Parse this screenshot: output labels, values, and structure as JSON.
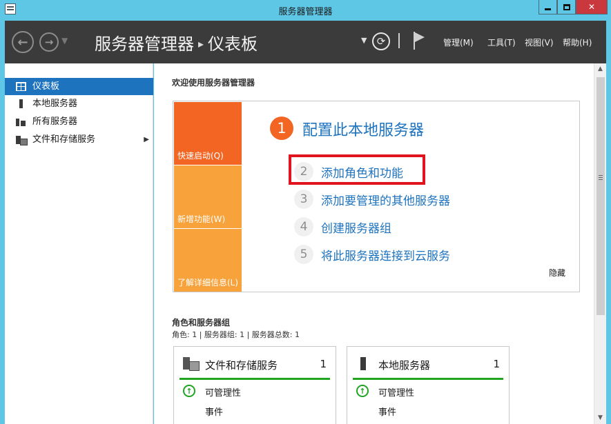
{
  "window": {
    "title": "服务器管理器"
  },
  "header": {
    "breadcrumb_root": "服务器管理器",
    "breadcrumb_separator": "▸",
    "breadcrumb_current": "仪表板",
    "menus": [
      "管理(M)",
      "工具(T)",
      "视图(V)",
      "帮助(H)"
    ]
  },
  "sidebar": {
    "items": [
      {
        "label": "仪表板",
        "icon": "dashboard-icon",
        "active": true
      },
      {
        "label": "本地服务器",
        "icon": "server-icon",
        "active": false
      },
      {
        "label": "所有服务器",
        "icon": "servers-icon",
        "active": false
      },
      {
        "label": "文件和存储服务",
        "icon": "file-storage-icon",
        "active": false,
        "expandable": true
      }
    ]
  },
  "welcome": {
    "title": "欢迎使用服务器管理器",
    "tiles": [
      "快速启动(Q)",
      "新增功能(W)",
      "了解详细信息(L)"
    ],
    "primary_step": {
      "number": "1",
      "label": "配置此本地服务器"
    },
    "steps": [
      {
        "number": "2",
        "label": "添加角色和功能",
        "highlighted": true
      },
      {
        "number": "3",
        "label": "添加要管理的其他服务器"
      },
      {
        "number": "4",
        "label": "创建服务器组"
      },
      {
        "number": "5",
        "label": "将此服务器连接到云服务"
      }
    ],
    "hide_label": "隐藏"
  },
  "roles": {
    "title": "角色和服务器组",
    "summary": "角色: 1 | 服务器组: 1 | 服务器总数: 1",
    "cards": [
      {
        "name": "文件和存储服务",
        "count": "1",
        "icon": "file-storage-icon",
        "status": "可管理性",
        "events": "事件"
      },
      {
        "name": "本地服务器",
        "count": "1",
        "icon": "server-icon",
        "status": "可管理性",
        "events": "事件"
      }
    ]
  },
  "colors": {
    "accent": "#1e73be",
    "quick_start": "#f26522",
    "tile": "#f7a23a",
    "status_ok": "#1fa51f",
    "highlight": "#e0141e",
    "header_bg": "#3b3b3b",
    "title_bar": "#5fc7e6"
  }
}
